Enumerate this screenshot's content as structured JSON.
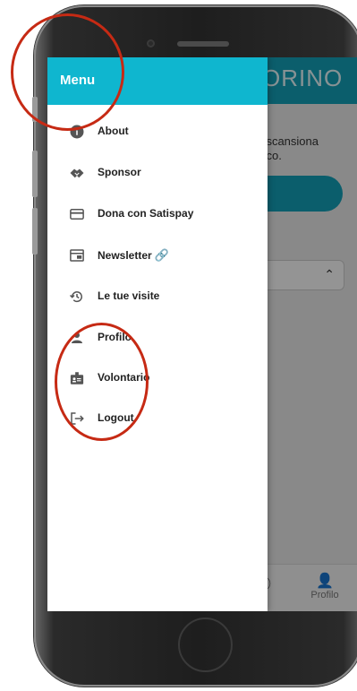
{
  "drawer": {
    "title": "Menu",
    "items": [
      {
        "label": "About",
        "icon": "info-icon"
      },
      {
        "label": "Sponsor",
        "icon": "handshake-icon"
      },
      {
        "label": "Dona con Satispay",
        "icon": "credit-card-icon"
      },
      {
        "label": "Newsletter",
        "icon": "newsletter-icon",
        "suffix": "🔗"
      },
      {
        "label": "Le tue visite",
        "icon": "history-icon"
      },
      {
        "label": "Profilo",
        "icon": "person-icon"
      },
      {
        "label": "Volontario",
        "icon": "badge-icon"
      },
      {
        "label": "Logout",
        "icon": "logout-icon"
      }
    ]
  },
  "app": {
    "header_title": "ORINO",
    "text": "o: scansiona\nenco.",
    "tabs": [
      {
        "label": "e",
        "icon": "location-icon"
      },
      {
        "label": "Profilo",
        "icon": "person-icon"
      }
    ],
    "select_caret": "⌃"
  },
  "colors": {
    "drawer_header": "#0fb6cf",
    "app_primary": "#14a3ba",
    "annotation": "#c62a14"
  }
}
